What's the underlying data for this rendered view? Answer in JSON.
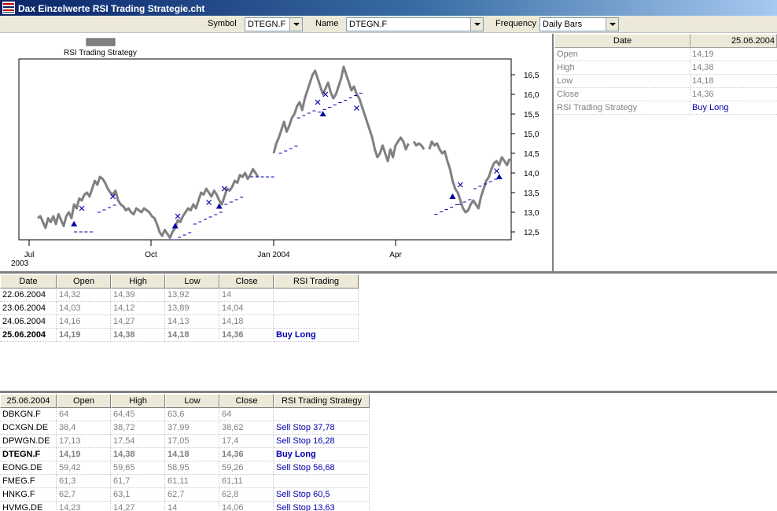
{
  "window": {
    "title": "Dax Einzelwerte RSI Trading Strategie.cht"
  },
  "toolbar": {
    "symbol_label": "Symbol",
    "symbol_value": "DTEGN.F",
    "name_label": "Name",
    "name_value": "DTEGN.F",
    "frequency_label": "Frequency",
    "frequency_value": "Daily Bars"
  },
  "chart_data": {
    "type": "line",
    "legend": [
      "RSI Trading Strategy"
    ],
    "x_tick_labels": [
      "Jul",
      "Oct",
      "Jan 2004",
      "Apr"
    ],
    "x_sub_label": "2003",
    "y_tick_labels": [
      "12,5",
      "13,0",
      "13,5",
      "14,0",
      "14,5",
      "15,0",
      "15,5",
      "16,0",
      "16,5"
    ],
    "ylim": [
      12.3,
      16.9
    ],
    "price_close": [
      12.85,
      12.9,
      12.75,
      12.6,
      12.85,
      12.75,
      12.9,
      12.7,
      12.95,
      12.8,
      12.65,
      12.9,
      13.0,
      12.85,
      13.2,
      13.1,
      13.35,
      13.3,
      13.45,
      13.5,
      13.4,
      13.6,
      13.8,
      13.7,
      13.9,
      13.85,
      13.75,
      13.6,
      13.5,
      13.45,
      13.55,
      13.3,
      13.2,
      13.15,
      13.05,
      13.1,
      13.0,
      12.95,
      13.1,
      13.05,
      13.0,
      13.1,
      13.05,
      13.0,
      12.9,
      12.85,
      12.7,
      12.5,
      12.4,
      12.55,
      12.45,
      12.35,
      12.5,
      12.6,
      12.8,
      12.75,
      12.9,
      13.0,
      13.1,
      13.05,
      13.2,
      13.1,
      13.3,
      13.5,
      13.45,
      13.6,
      13.5,
      13.4,
      13.55,
      13.45,
      13.3,
      13.2,
      13.4,
      13.6,
      13.55,
      13.65,
      13.8,
      13.75,
      13.95,
      13.9,
      14.0,
      13.85,
      13.95,
      14.1,
      14.0,
      13.9,
      null,
      null,
      null,
      null,
      null,
      14.5,
      14.75,
      14.9,
      15.1,
      15.3,
      15.05,
      15.2,
      15.4,
      15.5,
      15.7,
      15.8,
      15.6,
      15.9,
      16.1,
      16.3,
      16.5,
      16.6,
      16.4,
      16.2,
      16.0,
      16.15,
      16.3,
      16.05,
      15.9,
      16.0,
      16.2,
      16.4,
      16.7,
      16.5,
      16.3,
      16.1,
      16.2,
      16.0,
      15.9,
      15.7,
      15.5,
      15.3,
      15.1,
      14.9,
      14.6,
      14.4,
      14.5,
      14.7,
      14.5,
      14.3,
      14.6,
      14.4,
      14.7,
      14.8,
      14.9,
      14.8,
      14.6,
      14.75,
      null,
      14.8,
      14.7,
      14.75,
      14.7,
      14.6,
      null,
      14.6,
      14.8,
      14.7,
      14.75,
      14.6,
      14.5,
      14.55,
      14.3,
      14.1,
      13.8,
      13.6,
      13.5,
      13.3,
      13.1,
      13.0,
      13.05,
      13.2,
      13.3,
      13.2,
      13.1,
      13.4,
      13.6,
      13.8,
      13.9,
      14.1,
      14.25,
      14.3,
      14.2,
      14.4,
      14.3,
      14.2,
      14.36
    ],
    "buy_long_markers": [
      12.7,
      12.65,
      13.15,
      15.5,
      13.4,
      13.9
    ],
    "exit_markers": [
      13.1,
      13.4,
      12.9,
      13.6,
      13.25,
      15.8,
      16.0,
      15.65,
      13.7,
      14.05
    ]
  },
  "info_panel": {
    "header_label": "Date",
    "header_value": "25.06.2004",
    "rows": [
      {
        "k": "Open",
        "v": "14,19"
      },
      {
        "k": "High",
        "v": "14,38"
      },
      {
        "k": "Low",
        "v": "14,18"
      },
      {
        "k": "Close",
        "v": "14,36"
      },
      {
        "k": "RSI Trading Strategy",
        "v": "Buy Long",
        "signal": true
      }
    ]
  },
  "history_table": {
    "headers": [
      "Date",
      "Open",
      "High",
      "Low",
      "Close",
      "RSI Trading"
    ],
    "rows": [
      [
        "22.06.2004",
        "14,32",
        "14,39",
        "13,92",
        "14",
        ""
      ],
      [
        "23.06.2004",
        "14,03",
        "14,12",
        "13,89",
        "14,04",
        ""
      ],
      [
        "24.06.2004",
        "14,16",
        "14,27",
        "14,13",
        "14,18",
        ""
      ],
      [
        "25.06.2004",
        "14,19",
        "14,38",
        "14,18",
        "14,36",
        "Buy Long"
      ]
    ],
    "bold_row": 3
  },
  "portfolio_table": {
    "headers": [
      "25.06.2004",
      "Open",
      "High",
      "Low",
      "Close",
      "RSI Trading Strategy"
    ],
    "rows": [
      [
        "DBKGN.F",
        "64",
        "64,45",
        "63,6",
        "64",
        ""
      ],
      [
        "DCXGN.DE",
        "38,4",
        "38,72",
        "37,99",
        "38,62",
        "Sell Stop 37,78"
      ],
      [
        "DPWGN.DE",
        "17,13",
        "17,54",
        "17,05",
        "17,4",
        "Sell Stop 16,28"
      ],
      [
        "DTEGN.F",
        "14,19",
        "14,38",
        "14,18",
        "14,36",
        "Buy Long"
      ],
      [
        "EONG.DE",
        "59,42",
        "59,65",
        "58,95",
        "59,26",
        "Sell Stop 56,68"
      ],
      [
        "FMEG.F",
        "61,3",
        "61,7",
        "61,11",
        "61,11",
        ""
      ],
      [
        "HNKG.F",
        "62,7",
        "63,1",
        "62,7",
        "62,8",
        "Sell Stop 60,5"
      ],
      [
        "HVMG.DE",
        "14,23",
        "14,27",
        "14",
        "14,06",
        "Sell Stop 13,63"
      ]
    ],
    "bold_row": 3
  },
  "colors": {
    "price": "#808080",
    "signal": "#0000aa",
    "titlebar": "#0a246a"
  }
}
